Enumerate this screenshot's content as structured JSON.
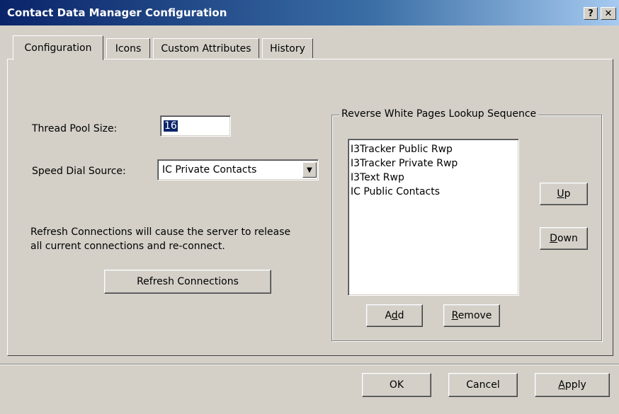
{
  "window": {
    "title": "Contact Data Manager Configuration",
    "help_glyph": "?",
    "close_glyph": "✕"
  },
  "tabs": [
    {
      "label": "Configuration",
      "active": true
    },
    {
      "label": "Icons",
      "active": false
    },
    {
      "label": "Custom Attributes",
      "active": false
    },
    {
      "label": "History",
      "active": false
    }
  ],
  "config": {
    "thread_pool_label": "Thread Pool Size:",
    "thread_pool_value": "16",
    "speed_dial_label": "Speed Dial Source:",
    "speed_dial_value": "IC Private Contacts",
    "refresh_note_line1": "Refresh Connections will cause the server to release",
    "refresh_note_line2": "all current connections and re-connect.",
    "refresh_button": "Refresh Connections"
  },
  "rwp": {
    "group_title": "Reverse White Pages Lookup Sequence",
    "items": [
      "I3Tracker Public Rwp",
      "I3Tracker Private Rwp",
      "I3Text Rwp",
      "IC Public Contacts"
    ],
    "up_label": "Up",
    "up_mnemonic": "U",
    "up_rest": "p",
    "down_mnemonic": "D",
    "down_rest": "own",
    "add_pre": "A",
    "add_mnemonic": "d",
    "add_post": "d",
    "remove_mnemonic": "R",
    "remove_rest": "emove"
  },
  "footer": {
    "ok_label": "OK",
    "cancel_label": "Cancel",
    "apply_mnemonic": "A",
    "apply_rest": "pply"
  }
}
